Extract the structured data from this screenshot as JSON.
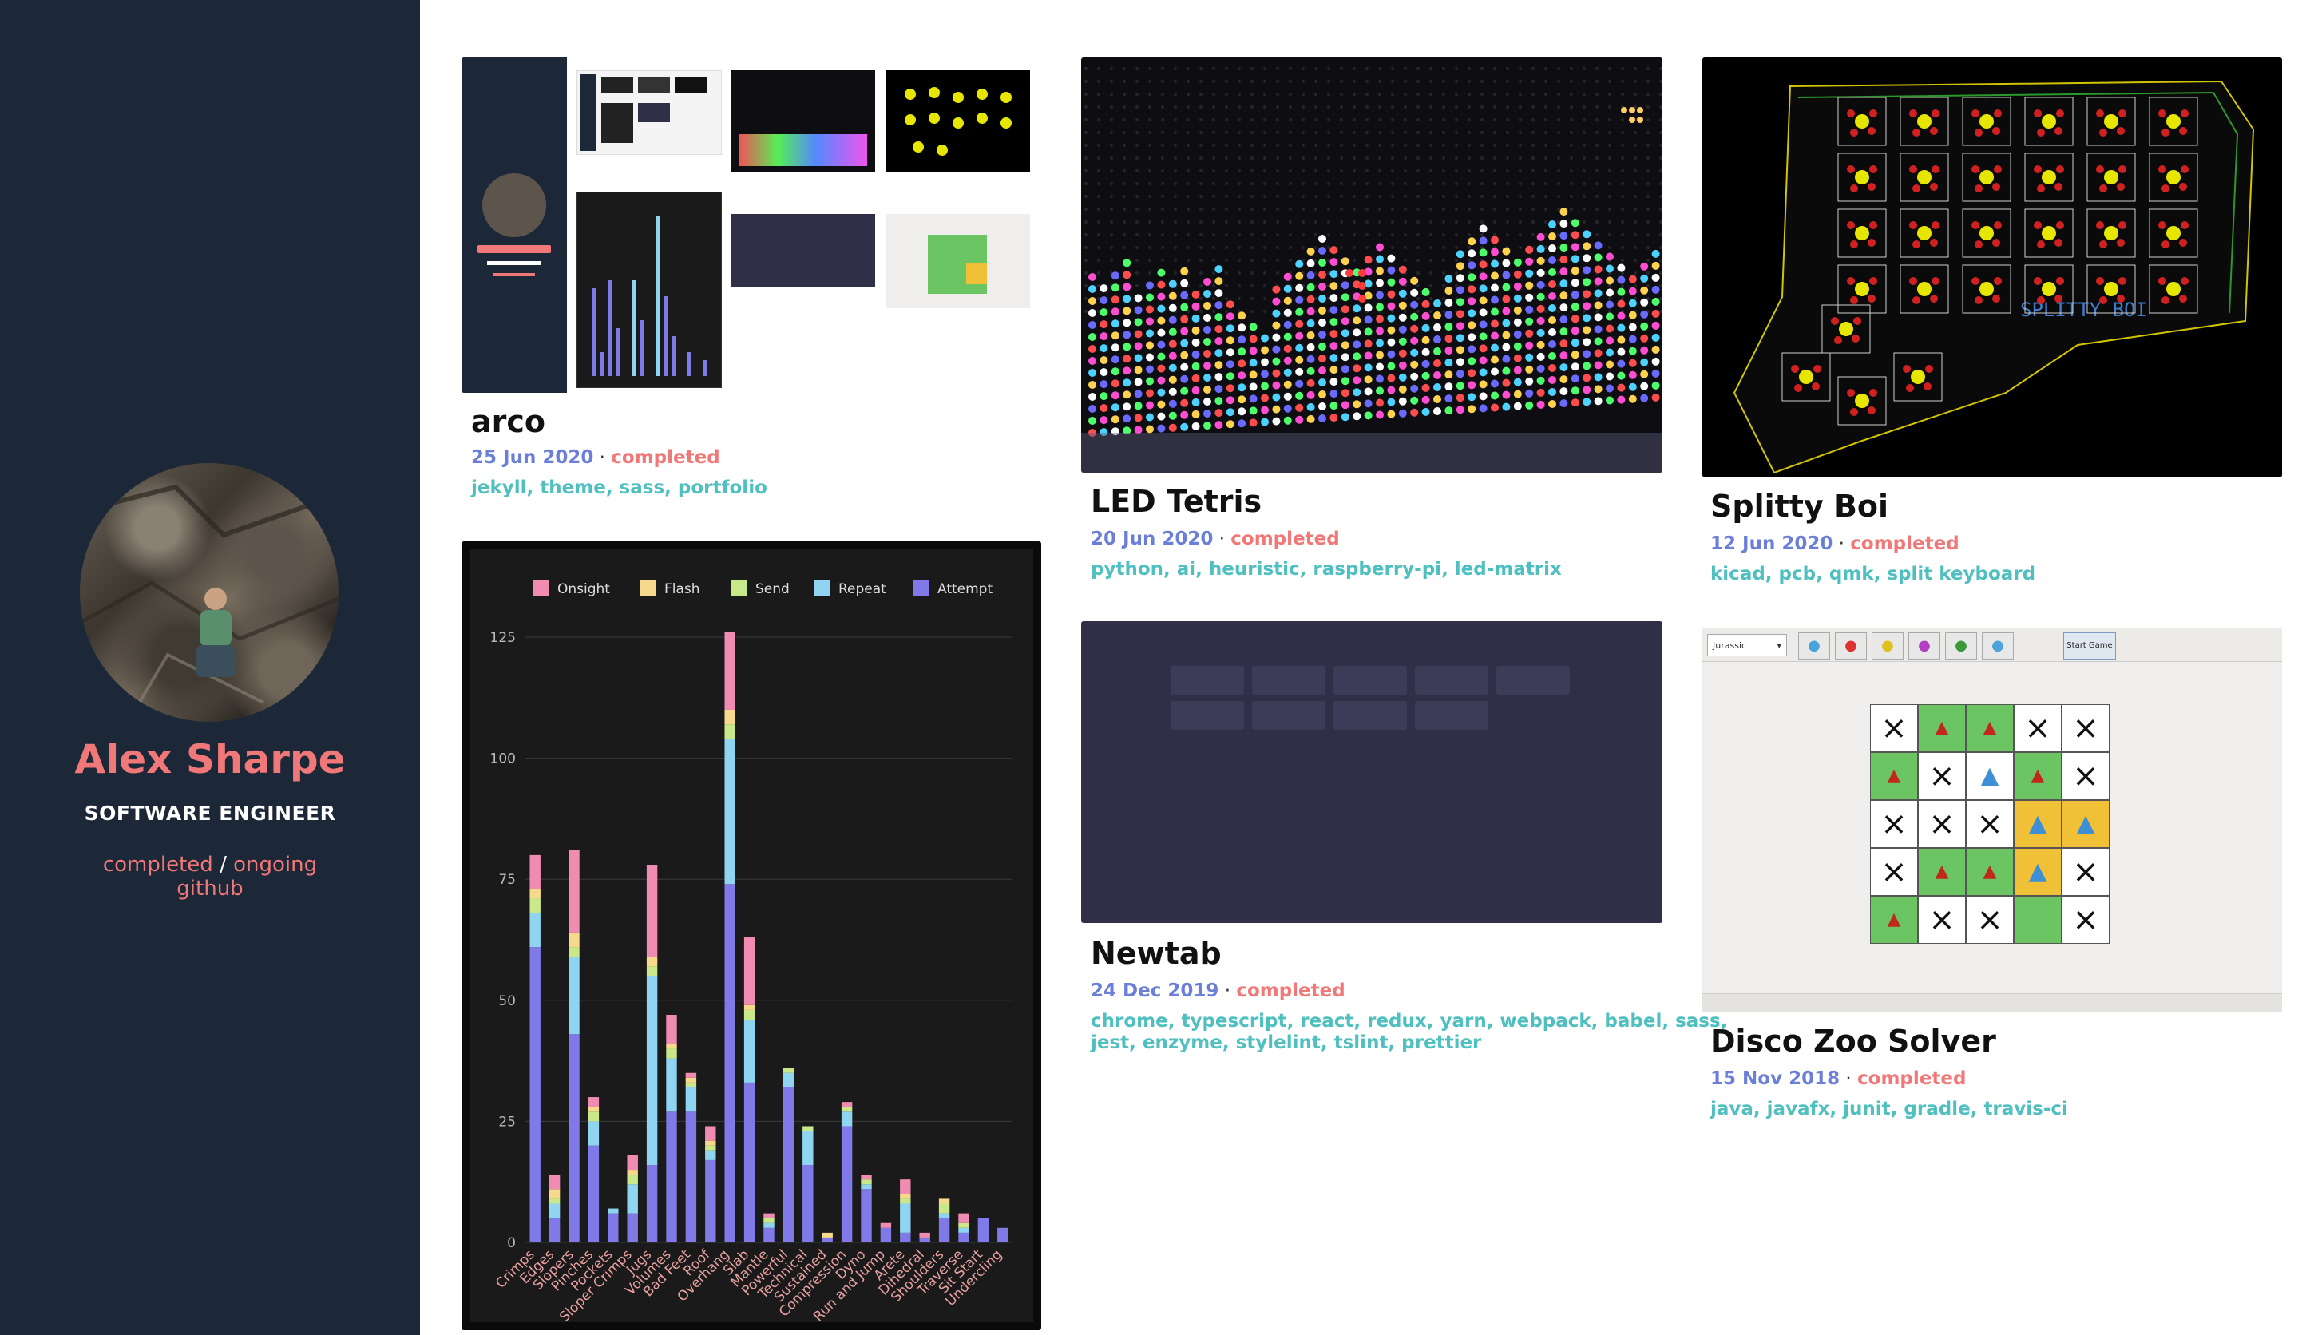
{
  "profile": {
    "name": "Alex Sharpe",
    "role": "SOFTWARE ENGINEER",
    "link_completed": "completed",
    "separator": "/",
    "link_ongoing": "ongoing",
    "link_github": "github"
  },
  "dot": "·",
  "projects": [
    {
      "title": "arco",
      "date": "25 Jun 2020",
      "status": "completed",
      "tags": "jekyll, theme, sass, portfolio"
    },
    {
      "title": "LED Tetris",
      "date": "20 Jun 2020",
      "status": "completed",
      "tags": "python, ai, heuristic, raspberry-pi, led-matrix"
    },
    {
      "title": "Splitty Boi",
      "date": "12 Jun 2020",
      "status": "completed",
      "tags": "kicad, pcb, qmk, split keyboard"
    },
    {
      "title": "Newtab",
      "date": "24 Dec 2019",
      "status": "completed",
      "tags_line1": "chrome, typescript, react, redux, yarn, webpack, babel, sass,",
      "tags_line2": "jest, enzyme, stylelint, tslint, prettier"
    },
    {
      "title": "Disco Zoo Solver",
      "date": "15 Nov 2018",
      "status": "completed",
      "tags": "java, javafx, junit, gradle, travis-ci"
    }
  ],
  "splitty_label": "SPLITTY BOI",
  "disco_toolbar": {
    "select_value": "Jurassic",
    "start_button": "Start Game"
  },
  "colors": {
    "sidebar_bg": "#1c2837",
    "accent_pink": "#f07878",
    "date_blue": "#6b7fd8",
    "tag_teal": "#4fbfbf",
    "chart_bg": "#1a1a1a"
  },
  "chart_data": {
    "type": "bar",
    "stacked": true,
    "legend": [
      "Onsight",
      "Flash",
      "Send",
      "Repeat",
      "Attempt"
    ],
    "legend_position": "top",
    "colors": [
      "#f08cb2",
      "#f7d98c",
      "#c9e88a",
      "#8fd4f0",
      "#8079e8"
    ],
    "ylim": [
      0,
      125
    ],
    "yticks": [
      0,
      25,
      50,
      75,
      100,
      125
    ],
    "categories": [
      "Crimps",
      "Edges",
      "Slopers",
      "Pinches",
      "Pockets",
      "Sloper Crimps",
      "Jugs",
      "Volumes",
      "Bad Feet",
      "Roof",
      "Overhang",
      "Slab",
      "Mantle",
      "Powerful",
      "Technical",
      "Sustained",
      "Compression",
      "Dyno",
      "Run and Jump",
      "Arete",
      "Dihedral",
      "Shoulders",
      "Traverse",
      "Sit Start",
      "Undercling"
    ],
    "series": [
      {
        "name": "Attempt",
        "values": [
          61,
          5,
          43,
          20,
          6,
          6,
          16,
          27,
          27,
          17,
          74,
          33,
          3,
          32,
          16,
          1,
          24,
          11,
          3,
          2,
          1,
          5,
          2,
          5,
          3
        ]
      },
      {
        "name": "Repeat",
        "values": [
          7,
          3,
          16,
          5,
          1,
          6,
          39,
          11,
          5,
          2,
          30,
          13,
          1,
          3,
          7,
          0,
          3,
          1,
          0,
          6,
          0,
          1,
          1,
          0,
          0
        ]
      },
      {
        "name": "Send",
        "values": [
          3,
          1,
          2,
          2,
          0,
          2,
          2,
          2,
          1,
          1,
          3,
          2,
          1,
          1,
          1,
          0,
          1,
          1,
          0,
          1,
          0,
          2,
          1,
          0,
          0
        ]
      },
      {
        "name": "Flash",
        "values": [
          2,
          2,
          3,
          1,
          0,
          1,
          2,
          1,
          1,
          1,
          3,
          1,
          0,
          0,
          0,
          1,
          0,
          0,
          0,
          1,
          0,
          1,
          0,
          0,
          0
        ]
      },
      {
        "name": "Onsight",
        "values": [
          7,
          3,
          17,
          2,
          0,
          3,
          19,
          6,
          1,
          3,
          16,
          14,
          1,
          0,
          0,
          0,
          1,
          1,
          1,
          3,
          1,
          0,
          2,
          0,
          0
        ]
      }
    ]
  }
}
